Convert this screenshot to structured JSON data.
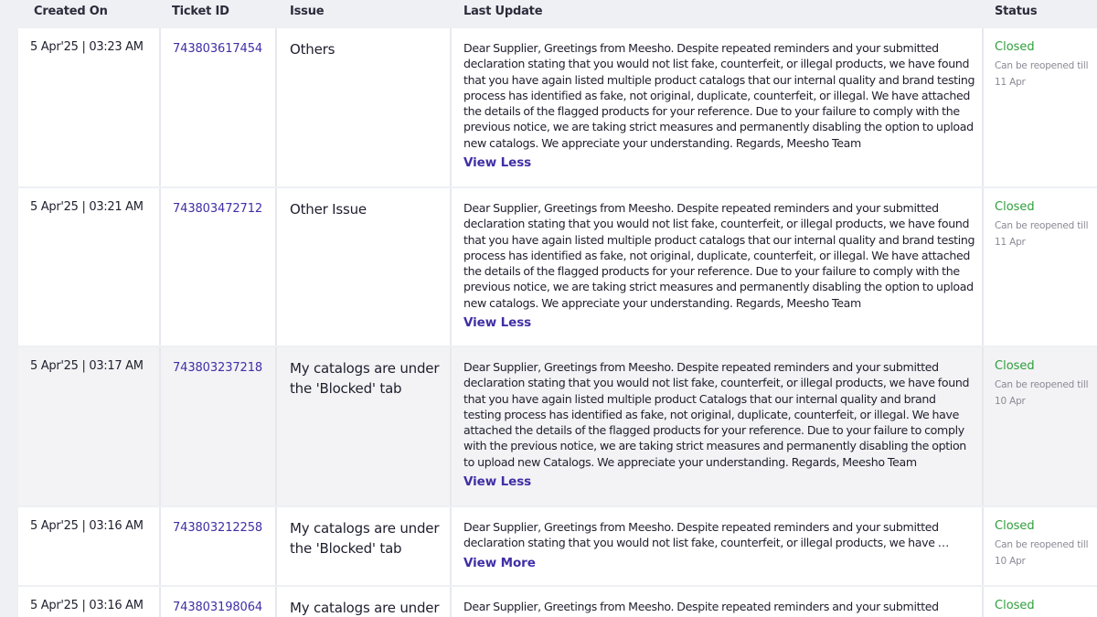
{
  "table": {
    "headers": {
      "created_on": "Created On",
      "ticket_id": "Ticket ID",
      "issue": "Issue",
      "last_update": "Last Update",
      "status": "Status"
    },
    "rows": [
      {
        "created_on": "5 Apr'25 | 03:23 AM",
        "ticket_id": "743803617454",
        "issue": "Others",
        "last_update": "Dear Supplier, Greetings from Meesho. Despite repeated reminders and your submitted declaration stating that you would not list fake, counterfeit, or illegal products, we have found that you have again listed multiple product catalogs that our internal quality and brand testing process has identified as fake, not original, duplicate, counterfeit, or illegal. We have attached the details of the flagged products for your reference. Due to your failure to comply with the previous notice, we are taking strict measures and permanently disabling the option to upload new catalogs. We appreciate your understanding. Regards, Meesho Team",
        "toggle": "View Less",
        "status": "Closed",
        "reopen_note": "Can be reopened till 11 Apr"
      },
      {
        "created_on": "5 Apr'25 | 03:21 AM",
        "ticket_id": "743803472712",
        "issue": "Other Issue",
        "last_update": "Dear Supplier, Greetings from Meesho. Despite repeated reminders and your submitted declaration stating that you would not list fake, counterfeit, or illegal products, we have found that you have again listed multiple product catalogs that our internal quality and brand testing process has identified as fake, not original, duplicate, counterfeit, or illegal. We have attached the details of the flagged products for your reference. Due to your failure to comply with the previous notice, we are taking strict measures and permanently disabling the option to upload new catalogs. We appreciate your understanding. Regards, Meesho Team",
        "toggle": "View Less",
        "status": "Closed",
        "reopen_note": "Can be reopened till 11 Apr"
      },
      {
        "created_on": "5 Apr'25 | 03:17 AM",
        "ticket_id": "743803237218",
        "issue": "My catalogs are under the 'Blocked' tab",
        "last_update": "Dear Supplier, Greetings from Meesho. Despite repeated reminders and your submitted declaration stating that you would not list fake, counterfeit, or illegal products, we have found that you have again listed multiple product Catalogs that our internal quality and brand testing process has identified as fake, not original, duplicate, counterfeit, or illegal. We have attached the details of the flagged products for your reference. Due to your failure to comply with the previous notice, we are taking strict measures and permanently disabling the option to upload new Catalogs. We appreciate your understanding. Regards, Meesho Team",
        "toggle": "View Less",
        "status": "Closed",
        "reopen_note": "Can be reopened till 10 Apr"
      },
      {
        "created_on": "5 Apr'25 | 03:16 AM",
        "ticket_id": "743803212258",
        "issue": "My catalogs are under the 'Blocked' tab",
        "last_update": "Dear Supplier, Greetings from Meesho. Despite repeated reminders and your submitted declaration stating that you would not list fake, counterfeit, or illegal products, we have …",
        "toggle": "View More",
        "status": "Closed",
        "reopen_note": "Can be reopened till 10 Apr"
      },
      {
        "created_on": "5 Apr'25 | 03:16 AM",
        "ticket_id": "743803198064",
        "issue": "My catalogs are under",
        "last_update": "Dear Supplier, Greetings from Meesho. Despite repeated reminders and your submitted",
        "status": "Closed"
      }
    ]
  }
}
